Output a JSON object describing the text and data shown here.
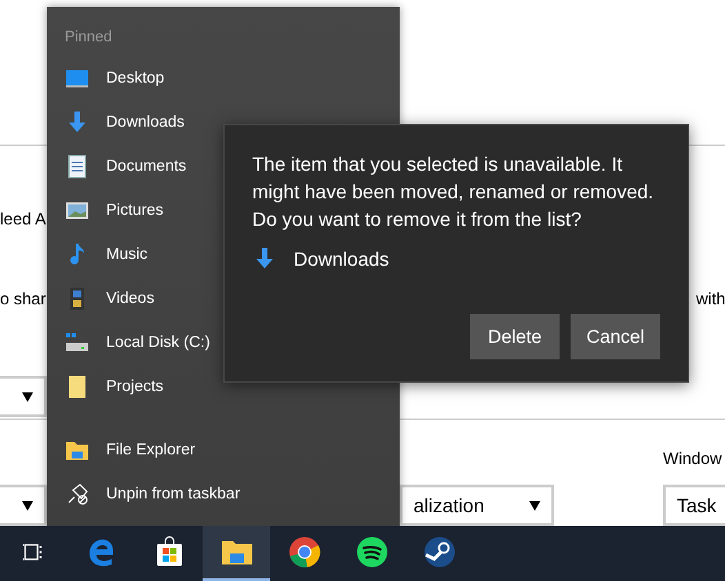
{
  "settings_page": {
    "label_1": "leed A",
    "label_2": "o shar",
    "label_3": "with",
    "label_4": "Window",
    "dropdown_1": "alization",
    "field_1": "Task"
  },
  "jump_list": {
    "header": "Pinned",
    "pinned": [
      {
        "kind": "desktop",
        "label": "Desktop"
      },
      {
        "kind": "download",
        "label": "Downloads"
      },
      {
        "kind": "document",
        "label": "Documents"
      },
      {
        "kind": "picture",
        "label": "Pictures"
      },
      {
        "kind": "music",
        "label": "Music"
      },
      {
        "kind": "video",
        "label": "Videos"
      },
      {
        "kind": "disk",
        "label": "Local Disk (C:)"
      },
      {
        "kind": "folder",
        "label": "Projects"
      }
    ],
    "tasks": [
      {
        "kind": "explorer",
        "label": "File Explorer"
      },
      {
        "kind": "unpin",
        "label": "Unpin from taskbar"
      }
    ]
  },
  "dialog": {
    "message": "The item that you selected is unavailable. It might have been moved, renamed or removed. Do you want to remove it from the list?",
    "item": "Downloads",
    "buttons": [
      "Delete",
      "Cancel"
    ]
  },
  "taskbar": {
    "apps": [
      {
        "kind": "taskview",
        "selected": false
      },
      {
        "kind": "edge",
        "selected": false
      },
      {
        "kind": "store",
        "selected": false
      },
      {
        "kind": "explorer",
        "selected": true
      },
      {
        "kind": "chrome",
        "selected": false
      },
      {
        "kind": "spotify",
        "selected": false
      },
      {
        "kind": "steam",
        "selected": false
      }
    ]
  }
}
